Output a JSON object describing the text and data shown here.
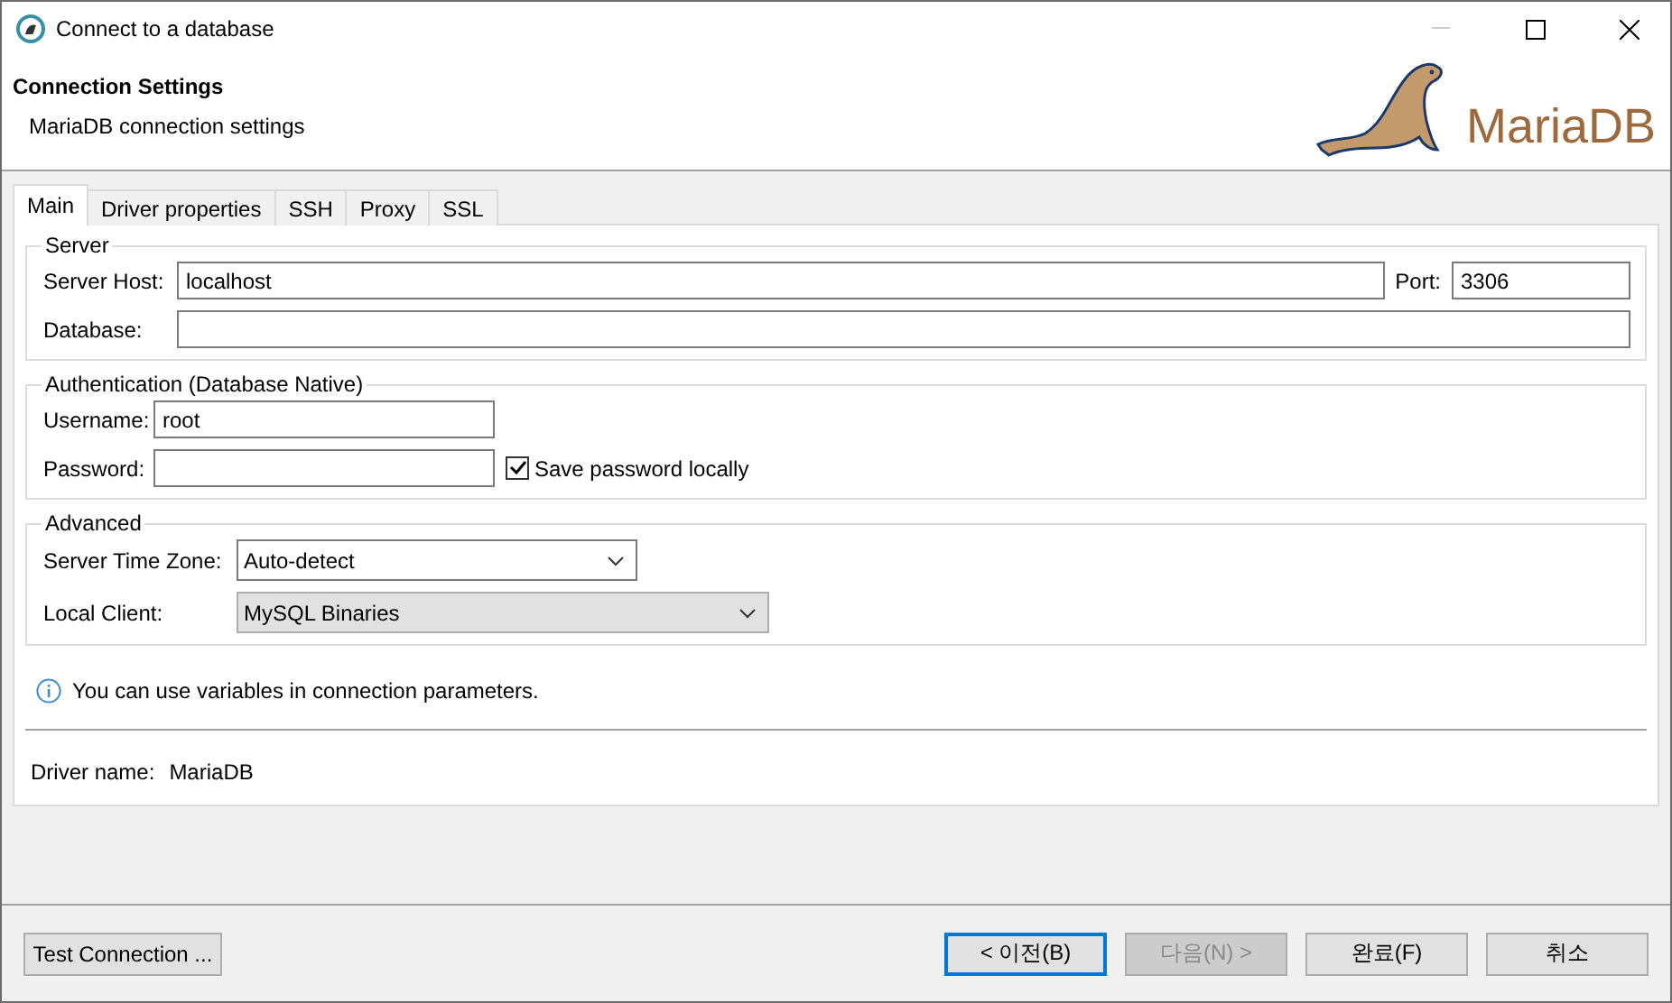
{
  "window": {
    "title": "Connect to a database"
  },
  "header": {
    "title": "Connection Settings",
    "subtitle": "MariaDB connection settings",
    "logo_text": "MariaDB"
  },
  "tabs": [
    {
      "label": "Main",
      "selected": true
    },
    {
      "label": "Driver properties",
      "selected": false
    },
    {
      "label": "SSH",
      "selected": false
    },
    {
      "label": "Proxy",
      "selected": false
    },
    {
      "label": "SSL",
      "selected": false
    }
  ],
  "server": {
    "legend": "Server",
    "host_label": "Server Host:",
    "host_value": "localhost",
    "port_label": "Port:",
    "port_value": "3306",
    "database_label": "Database:"
  },
  "authentication": {
    "legend": "Authentication (Database Native)",
    "username_label": "Username:",
    "username_value": "root",
    "password_label": "Password:",
    "save_password": {
      "label": "Save password locally",
      "checked": true
    }
  },
  "advanced": {
    "legend": "Advanced",
    "selects": [
      {
        "label": "Server Time Zone:",
        "value": "Auto-detect",
        "disabled": false
      },
      {
        "label": "Local Client:",
        "value": "MySQL Binaries",
        "disabled": true
      }
    ]
  },
  "info": "You can use variables in connection parameters.",
  "driver": {
    "label": "Driver name:",
    "value": "MariaDB"
  },
  "buttons": [
    {
      "label": "Test Connection ...",
      "focused": false,
      "disabled": false
    },
    {
      "label": "< 이전(B)",
      "focused": true,
      "disabled": false
    },
    {
      "label": "다음(N) >",
      "focused": false,
      "disabled": true
    },
    {
      "label": "완료(F)",
      "focused": false,
      "disabled": false
    },
    {
      "label": "취소",
      "focused": false,
      "disabled": false
    }
  ]
}
